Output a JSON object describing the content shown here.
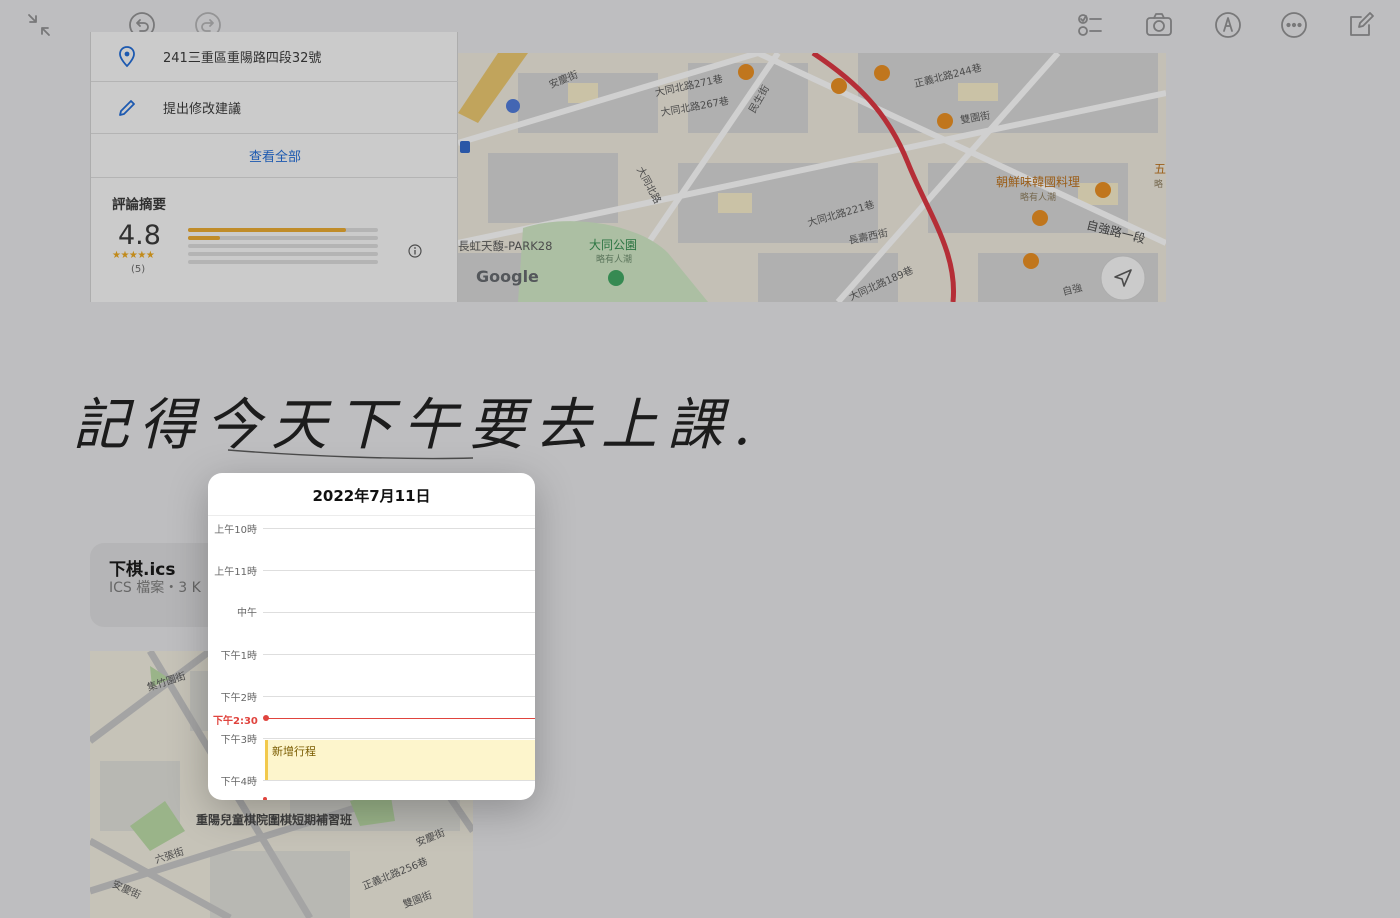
{
  "toolbar": {
    "left_icons": [
      "collapse-icon",
      "undo-icon",
      "redo-icon"
    ],
    "right_icons": [
      "checklist-icon",
      "camera-icon",
      "markup-pen-icon",
      "more-icon",
      "compose-icon"
    ]
  },
  "place_card": {
    "address": "241三重區重陽路四段32號",
    "suggest_edit": "提出修改建議",
    "see_all": "查看全部",
    "reviews_heading": "評論摘要",
    "rating": "4.8",
    "stars": "★★★★★",
    "review_count": "(5)",
    "rating_distribution": [
      0.83,
      0.17,
      0,
      0,
      0
    ]
  },
  "map_top": {
    "labels": [
      "安慶街",
      "大同北路271巷",
      "大同北路267巷",
      "民生街",
      "正義北路244巷",
      "雙園街",
      "朝鮮味韓國料理",
      "略有人潮",
      "大同北路",
      "大同北路221巷",
      "自強路一段",
      "長虹天馥-PARK28",
      "大同公園",
      "略有人潮",
      "長壽西街",
      "大同北路189巷",
      "自強",
      "五",
      "略"
    ],
    "google": "Google"
  },
  "handwriting": "記得今天下午要去上課.",
  "attachment": {
    "filename": "下棋.ics",
    "meta": "ICS 檔案・3 K"
  },
  "map_bottom": {
    "labels": [
      "集竹園街",
      "重陽兒童棋院圍棋短期補習班",
      "六張街",
      "安慶街",
      "安慶街",
      "正義北路256巷",
      "雙園街"
    ]
  },
  "calendar": {
    "date": "2022年7月11日",
    "hours": [
      "上午10時",
      "上午11時",
      "中午",
      "下午1時",
      "下午2時",
      "下午3時",
      "下午4時"
    ],
    "now_label": "下午2:30",
    "event_title": "新增行程",
    "accent": "#e0443e",
    "event_bg": "#fdf5cc",
    "event_border": "#f2c94c"
  }
}
